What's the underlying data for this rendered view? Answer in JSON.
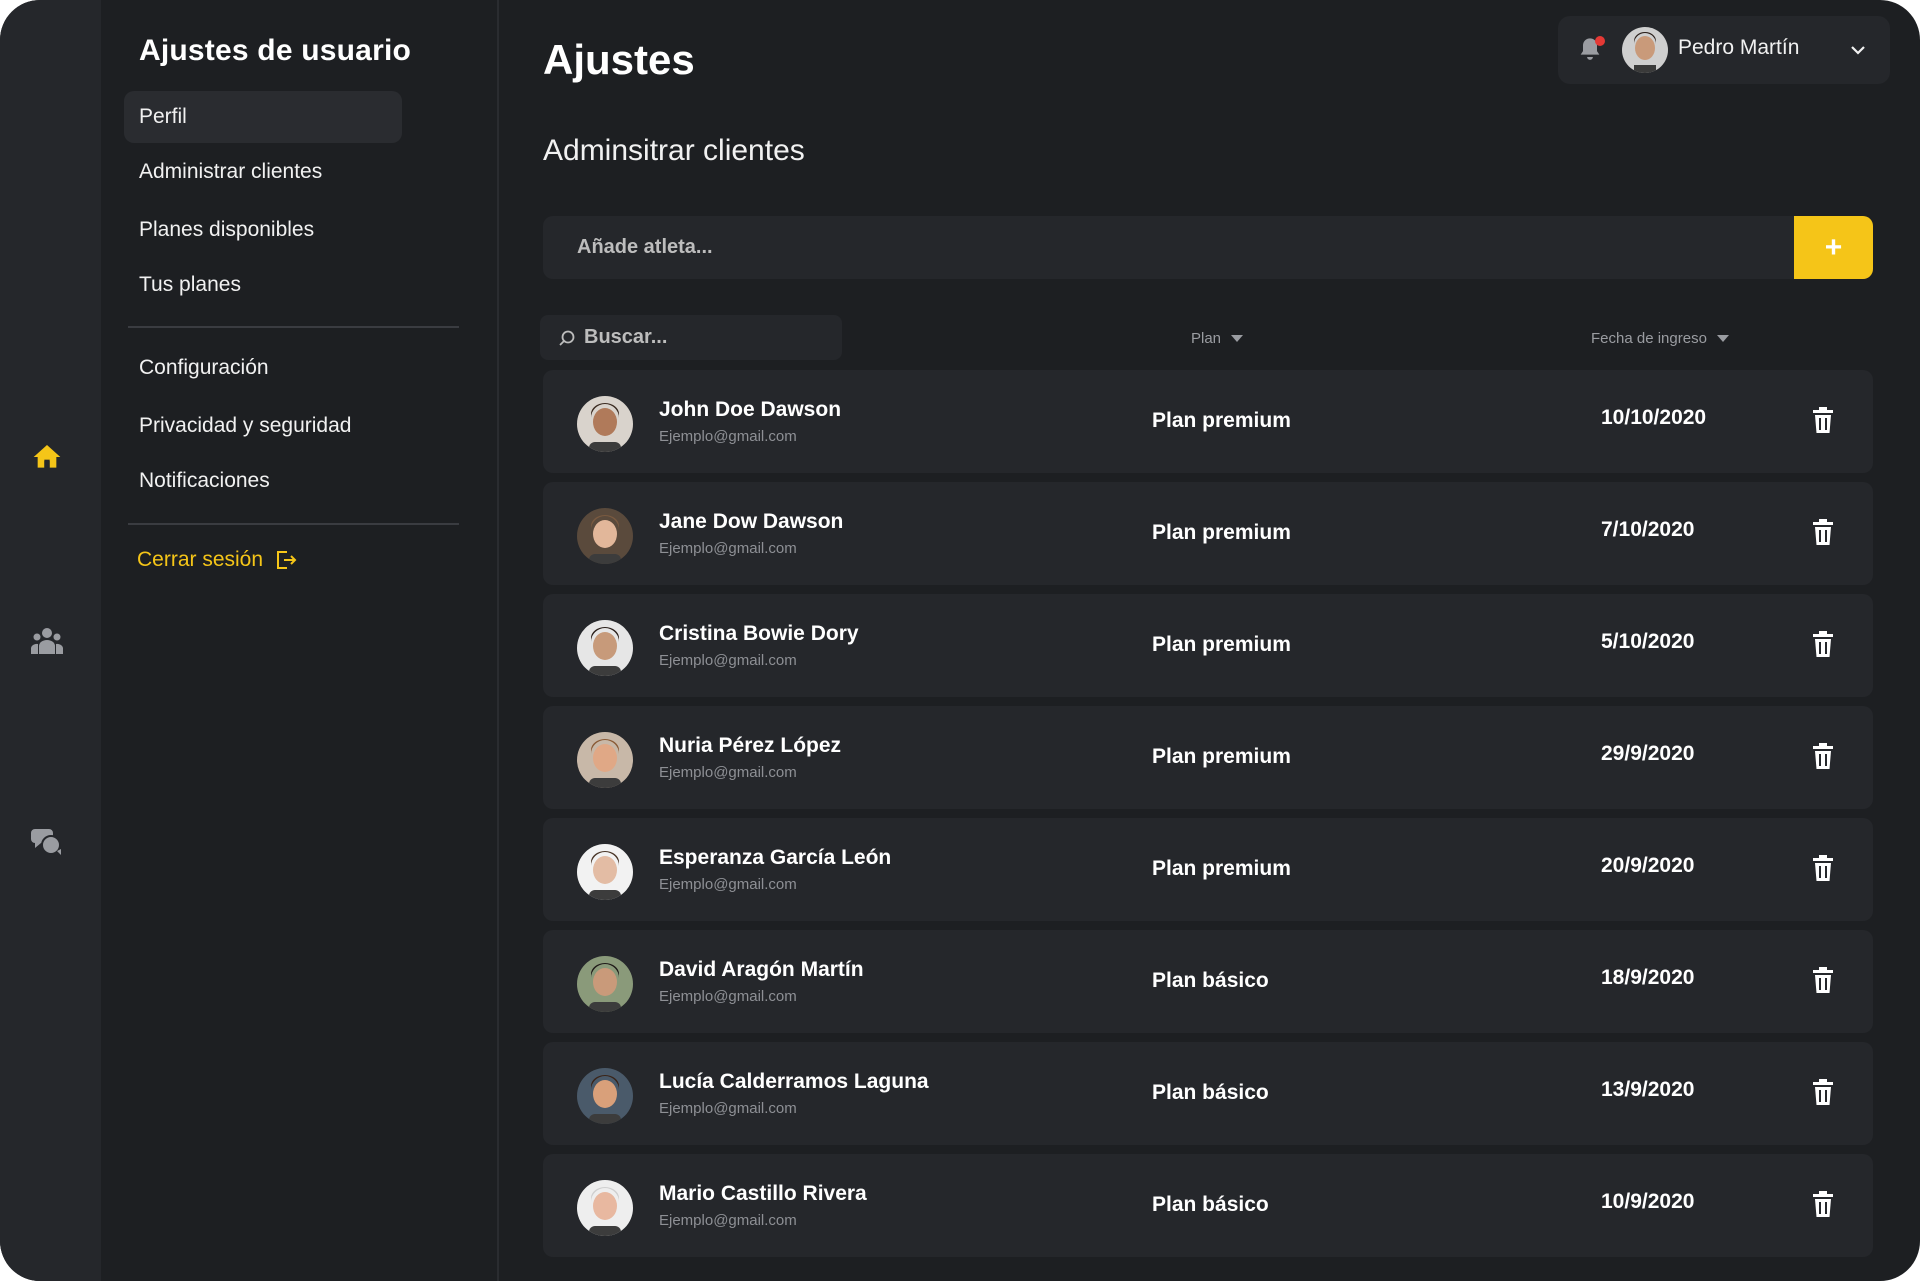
{
  "sidebar": {
    "title": "Ajustes de usuario",
    "items_top": [
      "Perfil",
      "Administrar clientes",
      "Planes disponibles",
      "Tus planes"
    ],
    "items_bottom": [
      "Configuración",
      "Privacidad y seguridad",
      "Notificaciones"
    ],
    "active_item": "Perfil",
    "logout_label": "Cerrar sesión"
  },
  "rail": {
    "icons": [
      "home-icon",
      "users-icon",
      "chat-icon"
    ],
    "active_icon": "home-icon"
  },
  "header": {
    "title": "Ajustes",
    "user_name": "Pedro Martín",
    "has_notification": true
  },
  "main": {
    "section_title": "Adminsitrar clientes",
    "add_placeholder": "Añade atleta...",
    "add_button": "+",
    "search_placeholder": "Buscar...",
    "columns": {
      "plan": "Plan",
      "date": "Fecha de ingreso"
    }
  },
  "clients": [
    {
      "name": "John Doe Dawson",
      "email": "Ejemplo@gmail.com",
      "plan": "Plan premium",
      "date": "10/10/2020",
      "avatar_skin": "#b07a5a",
      "avatar_hair": "#3a2a20",
      "avatar_bg": "#d9d3cc"
    },
    {
      "name": "Jane Dow Dawson",
      "email": "Ejemplo@gmail.com",
      "plan": "Plan premium",
      "date": "7/10/2020",
      "avatar_skin": "#e2b79a",
      "avatar_hair": "#7a5a40",
      "avatar_bg": "#5a4a3c"
    },
    {
      "name": "Cristina Bowie Dory",
      "email": "Ejemplo@gmail.com",
      "plan": "Plan premium",
      "date": "5/10/2020",
      "avatar_skin": "#c79a7a",
      "avatar_hair": "#2a1f1a",
      "avatar_bg": "#e6e6e6"
    },
    {
      "name": "Nuria Pérez López",
      "email": "Ejemplo@gmail.com",
      "plan": "Plan premium",
      "date": "29/9/2020",
      "avatar_skin": "#e0a886",
      "avatar_hair": "#8a5a35",
      "avatar_bg": "#c8b8a8"
    },
    {
      "name": "Esperanza García León",
      "email": "Ejemplo@gmail.com",
      "plan": "Plan premium",
      "date": "20/9/2020",
      "avatar_skin": "#e3bca4",
      "avatar_hair": "#4a3628",
      "avatar_bg": "#f2f2f2"
    },
    {
      "name": "David Aragón Martín",
      "email": "Ejemplo@gmail.com",
      "plan": "Plan básico",
      "date": "18/9/2020",
      "avatar_skin": "#c99a7a",
      "avatar_hair": "#1f1a18",
      "avatar_bg": "#8a9a7a"
    },
    {
      "name": "Lucía Calderramos Laguna",
      "email": "Ejemplo@gmail.com",
      "plan": "Plan básico",
      "date": "13/9/2020",
      "avatar_skin": "#d9a07a",
      "avatar_hair": "#3a2418",
      "avatar_bg": "#4a5a6a"
    },
    {
      "name": "Mario Castillo Rivera",
      "email": "Ejemplo@gmail.com",
      "plan": "Plan básico",
      "date": "10/9/2020",
      "avatar_skin": "#e8b8a0",
      "avatar_hair": "#cfcfcf",
      "avatar_bg": "#eeeeee"
    }
  ],
  "colors": {
    "accent": "#f5c518",
    "background": "#1d1f22",
    "panel": "#25272b",
    "notification": "#e53935"
  }
}
